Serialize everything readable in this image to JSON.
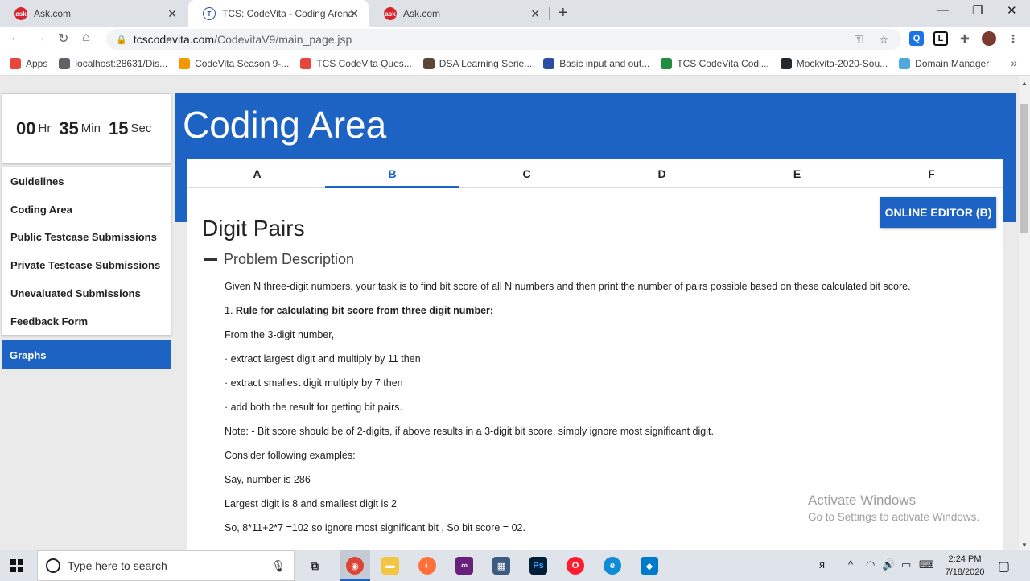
{
  "browser": {
    "tabs": [
      {
        "title": "Ask.com",
        "active": false
      },
      {
        "title": "TCS: CodeVita - Coding Arena",
        "active": true
      },
      {
        "title": "Ask.com",
        "active": false
      }
    ],
    "url_host": "tcscodevita.com",
    "url_path": "/CodevitaV9/main_page.jsp",
    "bookmarks": [
      {
        "label": "Apps",
        "icon": "apps-grid-icon",
        "color": "#e8453c"
      },
      {
        "label": "localhost:28631/Dis...",
        "icon": "globe-icon",
        "color": "#5f6368"
      },
      {
        "label": "CodeVita Season 9-...",
        "icon": "codevita-icon",
        "color": "#f29900"
      },
      {
        "label": "TCS CodeVita Ques...",
        "icon": "tcs-icon",
        "color": "#e8453c"
      },
      {
        "label": "DSA Learning Serie...",
        "icon": "codechef-icon",
        "color": "#5b4638"
      },
      {
        "label": "Basic input and out...",
        "icon": "geeks-icon",
        "color": "#2b4ea0"
      },
      {
        "label": "TCS CodeVita Codi...",
        "icon": "play-icon",
        "color": "#1e8e3e"
      },
      {
        "label": "Mockvita-2020-Sou...",
        "icon": "github-icon",
        "color": "#24292e"
      },
      {
        "label": "Domain Manager",
        "icon": "domain-icon",
        "color": "#4ea8de"
      }
    ]
  },
  "timer": {
    "hours": "00",
    "hr_unit": "Hr",
    "minutes": "35",
    "min_unit": "Min",
    "seconds": "15",
    "sec_unit": "Sec"
  },
  "sidebar": {
    "items": [
      {
        "label": "Guidelines"
      },
      {
        "label": "Coding Area"
      },
      {
        "label": "Public Testcase Submissions"
      },
      {
        "label": "Private Testcase Submissions"
      },
      {
        "label": "Unevaluated Submissions"
      },
      {
        "label": "Feedback Form"
      }
    ],
    "graphs_label": "Graphs"
  },
  "banner": {
    "title": "Coding Area"
  },
  "problem_tabs": [
    "A",
    "B",
    "C",
    "D",
    "E",
    "F"
  ],
  "active_tab": "B",
  "online_editor_label": "ONLINE EDITOR (B)",
  "problem": {
    "title": "Digit Pairs",
    "section_label": "Problem Description",
    "intro": "Given N three-digit numbers, your task is to find bit score of all N numbers and then print the number of pairs possible based on these calculated bit score.",
    "rule_prefix": "1. ",
    "rule_heading": "Rule for calculating bit score from three digit number:",
    "lines": [
      "From the 3-digit number,",
      "· extract largest digit and multiply by 11 then",
      "· extract smallest digit multiply by 7 then",
      "· add both the result for getting bit pairs.",
      "Note: - Bit score should be of 2-digits, if above results in a 3-digit bit score, simply ignore most significant digit.",
      "Consider following examples:",
      "Say, number is 286",
      "Largest digit is 8 and smallest digit is 2",
      "So, 8*11+2*7 =102 so ignore most significant bit , So bit score = 02."
    ]
  },
  "watermark": {
    "line1": "Activate Windows",
    "line2": "Go to Settings to activate Windows."
  },
  "taskbar": {
    "search_placeholder": "Type here to search",
    "time": "2:24 PM",
    "date": "7/18/2020"
  },
  "colors": {
    "accent": "#1d63c4",
    "page_bg": "#eaeaea"
  }
}
